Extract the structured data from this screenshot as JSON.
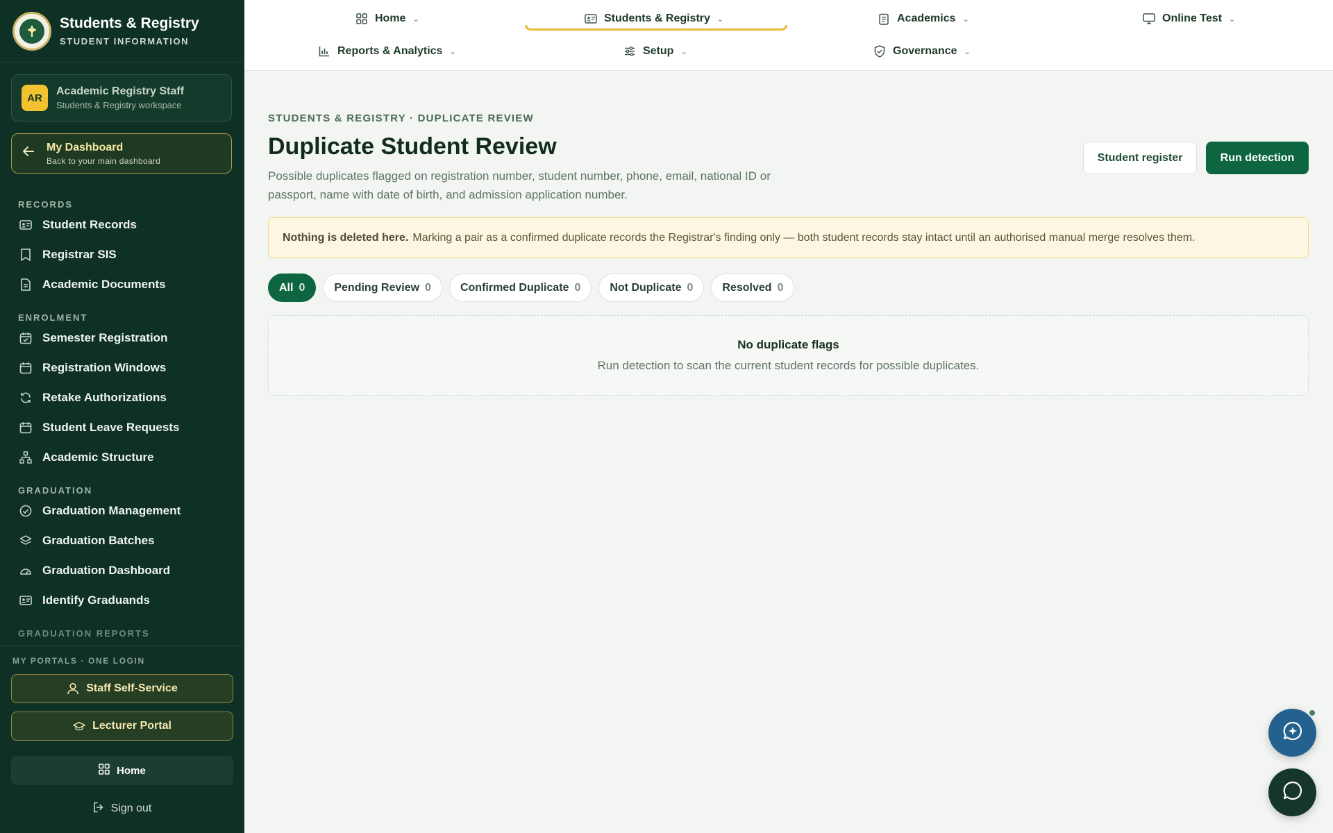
{
  "brand": {
    "title": "Students & Registry",
    "subtitle": "STUDENT INFORMATION"
  },
  "user": {
    "initials": "AR",
    "name": "Academic Registry Staff",
    "workspace": "Students & Registry workspace"
  },
  "dashboard": {
    "title": "My Dashboard",
    "subtitle": "Back to your main dashboard"
  },
  "sidebar": {
    "sections": [
      {
        "heading": "RECORDS",
        "items": [
          {
            "label": "Student Records",
            "icon": "id-card-icon"
          },
          {
            "label": "Registrar SIS",
            "icon": "bookmark-icon"
          },
          {
            "label": "Academic Documents",
            "icon": "document-icon"
          }
        ]
      },
      {
        "heading": "ENROLMENT",
        "items": [
          {
            "label": "Semester Registration",
            "icon": "calendar-check-icon"
          },
          {
            "label": "Registration Windows",
            "icon": "calendar-icon"
          },
          {
            "label": "Retake Authorizations",
            "icon": "refresh-icon"
          },
          {
            "label": "Student Leave Requests",
            "icon": "calendar-icon"
          },
          {
            "label": "Academic Structure",
            "icon": "hierarchy-icon"
          }
        ]
      },
      {
        "heading": "GRADUATION",
        "items": [
          {
            "label": "Graduation Management",
            "icon": "check-circle-icon"
          },
          {
            "label": "Graduation Batches",
            "icon": "layers-icon"
          },
          {
            "label": "Graduation Dashboard",
            "icon": "gauge-icon"
          },
          {
            "label": "Identify Graduands",
            "icon": "id-card-icon"
          }
        ]
      }
    ],
    "cutoff_heading": "GRADUATION REPORTS"
  },
  "portals": {
    "heading": "MY PORTALS · ONE LOGIN",
    "staff": "Staff Self-Service",
    "lecturer": "Lecturer Portal",
    "home": "Home",
    "signout": "Sign out"
  },
  "topnav": {
    "home": "Home",
    "students": "Students & Registry",
    "academics": "Academics",
    "online_test": "Online Test",
    "reports": "Reports & Analytics",
    "setup": "Setup",
    "governance": "Governance"
  },
  "page": {
    "breadcrumb": "STUDENTS & REGISTRY · DUPLICATE REVIEW",
    "title": "Duplicate Student Review",
    "description": "Possible duplicates flagged on registration number, student number, phone, email, national ID or passport, name with date of birth, and admission application number.",
    "btn_register": "Student register",
    "btn_run": "Run detection"
  },
  "notice": {
    "bold": "Nothing is deleted here.",
    "text": "Marking a pair as a confirmed duplicate records the Registrar's finding only — both student records stay intact until an authorised manual merge resolves them."
  },
  "filters": [
    {
      "label": "All",
      "count": "0"
    },
    {
      "label": "Pending Review",
      "count": "0"
    },
    {
      "label": "Confirmed Duplicate",
      "count": "0"
    },
    {
      "label": "Not Duplicate",
      "count": "0"
    },
    {
      "label": "Resolved",
      "count": "0"
    }
  ],
  "empty": {
    "title": "No duplicate flags",
    "subtitle": "Run detection to scan the current student records for possible duplicates."
  },
  "colors": {
    "sidebar": "#0f3024",
    "primary": "#0d6640",
    "accent": "#eab739",
    "notice_bg": "#fdf7e1"
  }
}
